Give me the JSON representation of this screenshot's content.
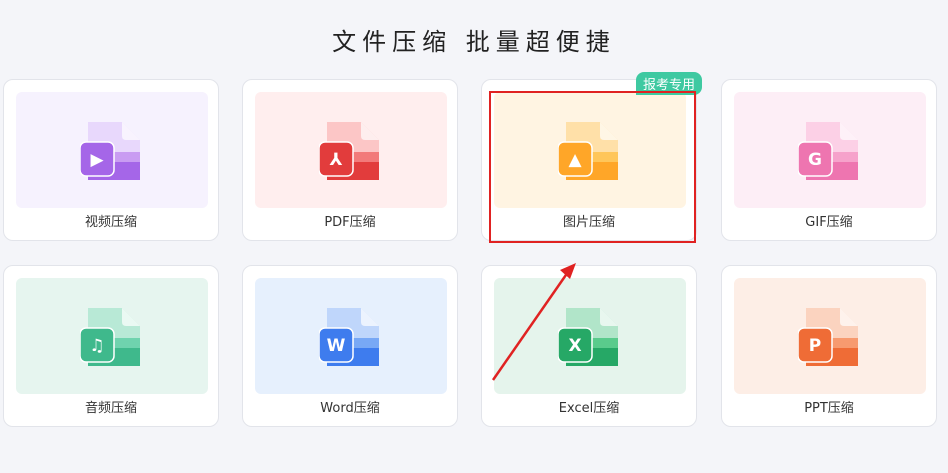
{
  "headline": "文件压缩  批量超便捷",
  "cards": [
    {
      "label": "视频压缩",
      "bg": "#f6f2fe",
      "light": "#e8d8fc",
      "mid": "#c99cf2",
      "dark": "#a566e8",
      "glyph": "▶"
    },
    {
      "label": "PDF压缩",
      "bg": "#ffeeee",
      "light": "#fcc6c6",
      "mid": "#f27a7a",
      "dark": "#e23c3c",
      "glyph": "⅄"
    },
    {
      "label": "图片压缩",
      "bg": "#fff4e2",
      "light": "#ffe0a8",
      "mid": "#ffc65a",
      "dark": "#ffa628",
      "glyph": "▲",
      "badge": "报考专用"
    },
    {
      "label": "GIF压缩",
      "bg": "#fdeef6",
      "light": "#fcd0e6",
      "mid": "#f6a2cb",
      "dark": "#ee75b0",
      "glyph": "G"
    },
    {
      "label": "音频压缩",
      "bg": "#e6f5ef",
      "light": "#b8e9d6",
      "mid": "#6fd3ae",
      "dark": "#3fb98c",
      "glyph": "♫"
    },
    {
      "label": "Word压缩",
      "bg": "#e6f0fd",
      "light": "#bfd6fb",
      "mid": "#78a8f5",
      "dark": "#3e7cee",
      "glyph": "W"
    },
    {
      "label": "Excel压缩",
      "bg": "#e5f4ec",
      "light": "#b1e5c9",
      "mid": "#5acb8c",
      "dark": "#26a866",
      "glyph": "X"
    },
    {
      "label": "PPT压缩",
      "bg": "#fdeee6",
      "light": "#fbd3bf",
      "mid": "#f79a6f",
      "dark": "#ef6c36",
      "glyph": "P"
    }
  ],
  "colors": {
    "highlight": "#e02222",
    "badge": "#3ec9a1"
  }
}
